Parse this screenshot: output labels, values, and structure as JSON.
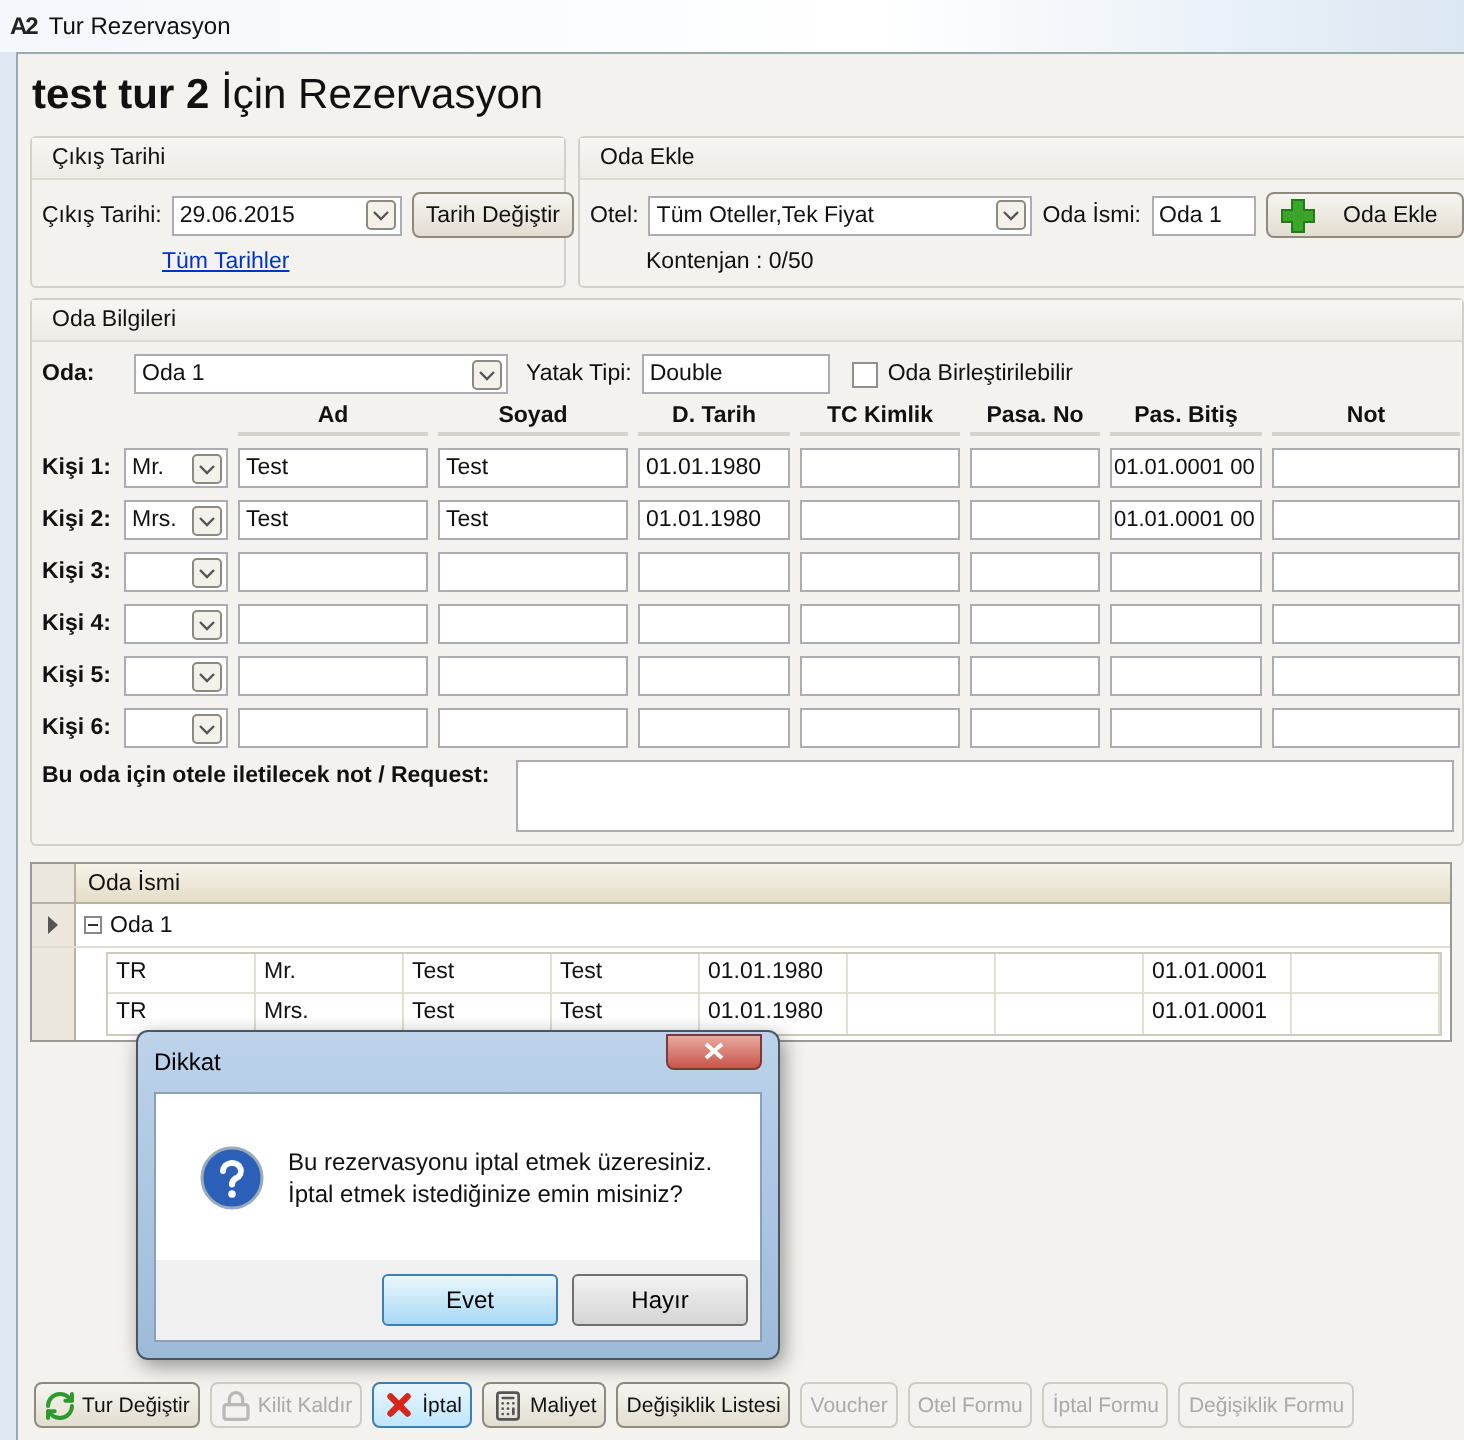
{
  "window": {
    "logo": "A2",
    "title": "Tur Rezervasyon"
  },
  "heading": "**test tur 2** İçin Rezervasyon",
  "departure": {
    "title": "Çıkış Tarihi",
    "label": "Çıkış Tarihi:",
    "value": "29.06.2015",
    "button": "Tarih Değiştir",
    "link": "Tüm Tarihler"
  },
  "add_room": {
    "title": "Oda Ekle",
    "hotel_label": "Otel:",
    "hotel_value": "Tüm Oteller,Tek Fiyat",
    "room_name_label": "Oda İsmi:",
    "room_name_value": "Oda 1",
    "button": "Oda Ekle",
    "quota": "Kontenjan : 0/50"
  },
  "room_info": {
    "title": "Oda Bilgileri",
    "room_label": "Oda:",
    "room_value": "Oda 1",
    "bed_label": "Yatak Tipi:",
    "bed_value": "Double",
    "combinable": {
      "label": "Oda Birleştirilebilir",
      "checked": false
    },
    "columns": [
      "Ad",
      "Soyad",
      "D. Tarih",
      "TC Kimlik",
      "Pasa. No",
      "Pas. Bitiş",
      "Not"
    ],
    "persons": [
      {
        "label": "Kişi 1:",
        "title": "Mr.",
        "fields": {
          "col_1": "Test",
          "col_2": "Test",
          "col_3": "01.01.1980",
          "col_6": "01.01.0001 00"
        }
      },
      {
        "label": "Kişi 2:",
        "title": "Mrs.",
        "fields": {
          "col_1": "Test",
          "col_2": "Test",
          "col_3": "01.01.1980",
          "col_6": "01.01.0001 00"
        }
      },
      {
        "label": "Kişi 3:"
      },
      {
        "label": "Kişi 4:"
      },
      {
        "label": "Kişi 5:"
      },
      {
        "label": "Kişi 6:"
      }
    ],
    "note_label": "Bu oda için otele iletilecek not / Request:"
  },
  "rooms_grid": {
    "column": "Oda İsmi",
    "rooms": [
      {
        "name": "Oda 1",
        "expanded": true,
        "selected": true,
        "rows": [
          {
            "cells": {
              "col_1": "TR",
              "col_2": "Mr.",
              "col_3": "Test",
              "col_4": "Test",
              "col_5": "01.01.1980",
              "col_8": "01.01.0001"
            }
          },
          {
            "cells": {
              "col_1": "TR",
              "col_2": "Mrs.",
              "col_3": "Test",
              "col_4": "Test",
              "col_5": "01.01.1980",
              "col_8": "01.01.0001"
            }
          }
        ]
      }
    ]
  },
  "dialog": {
    "title": "Dikkat",
    "message": [
      "Bu rezervasyonu iptal etmek üzeresiniz.",
      "İptal etmek istediğinize emin misiniz?"
    ],
    "buttons": [
      {
        "label": "Evet",
        "default": true
      },
      {
        "label": "Hayır",
        "default": false
      }
    ]
  },
  "toolbar": [
    {
      "label": "Tur Değiştir",
      "kind": "refresh",
      "disabled": false,
      "focused": false
    },
    {
      "label": "Kilit Kaldır",
      "kind": "lock",
      "disabled": true,
      "focused": false
    },
    {
      "label": "İptal",
      "kind": "cross",
      "disabled": false,
      "focused": true
    },
    {
      "label": "Maliyet",
      "kind": "calculator",
      "disabled": false,
      "focused": false
    },
    {
      "label": "Değişiklik Listesi",
      "disabled": false,
      "focused": false
    },
    {
      "label": "Voucher",
      "disabled": true,
      "focused": false
    },
    {
      "label": "Otel Formu",
      "disabled": true,
      "focused": false
    },
    {
      "label": "İptal Formu",
      "disabled": true,
      "focused": false
    },
    {
      "label": "Değişiklik Formu",
      "disabled": true,
      "focused": false
    }
  ]
}
